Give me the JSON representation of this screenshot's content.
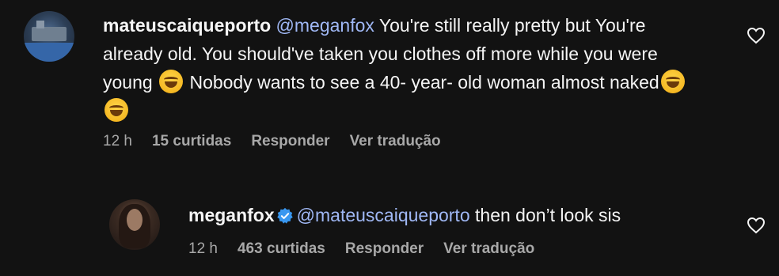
{
  "comment1": {
    "username": "mateuscaiqueporto",
    "mention": "@meganfox",
    "text_part1": " You're still really pretty but You're already old. You should've taken you clothes off more while you were young ",
    "text_part2": " Nobody wants to see a 40- year- old woman almost naked",
    "time": "12 h",
    "likes": "15 curtidas",
    "reply": "Responder",
    "translate": "Ver tradução"
  },
  "comment2": {
    "username": "meganfox",
    "mention": "@mateuscaiqueporto",
    "text": " then don’t look sis",
    "time": "12 h",
    "likes": "463 curtidas",
    "reply": "Responder",
    "translate": "Ver tradução"
  },
  "icons": {
    "like": "heart-outline-icon",
    "verified": "verified-badge-icon",
    "emoji": "face-with-tears-of-joy"
  },
  "colors": {
    "background": "#121212",
    "mention": "#a0b8f5",
    "meta": "#a8a8a8",
    "verified": "#3897f0"
  }
}
